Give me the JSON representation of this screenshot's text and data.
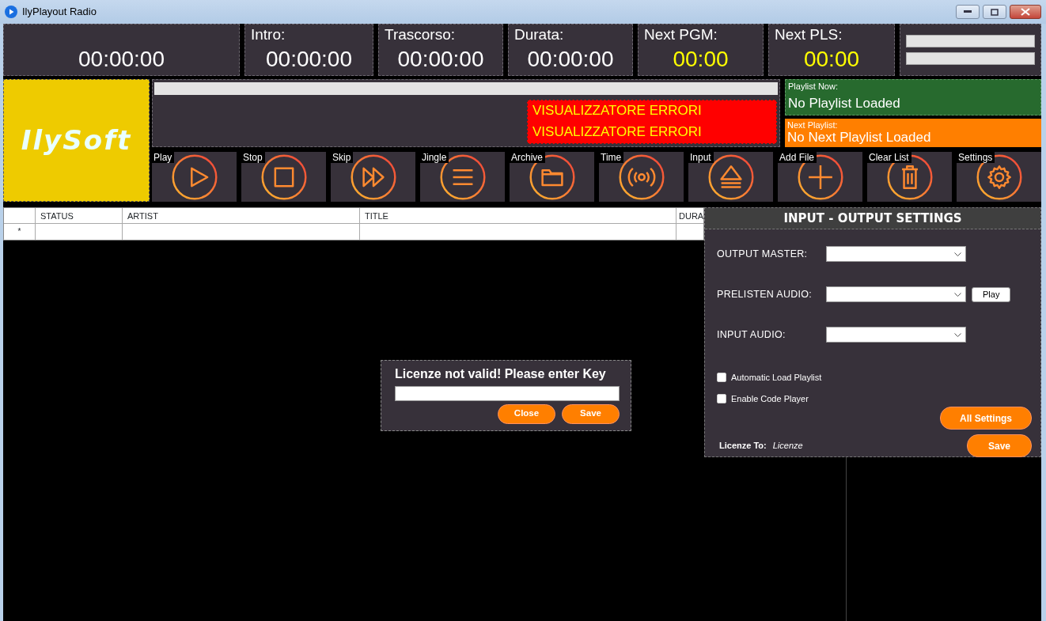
{
  "window": {
    "title": "IlyPlayout Radio"
  },
  "timers": [
    {
      "value": "00:00:00",
      "kind": "time"
    },
    {
      "label": "Intro:",
      "value": "00:00:00",
      "kind": "time"
    },
    {
      "label": "Trascorso:",
      "value": "00:00:00",
      "kind": "time"
    },
    {
      "label": "Durata:",
      "value": "00:00:00",
      "kind": "time"
    },
    {
      "label": "Next PGM:",
      "value": "00:00",
      "kind": "next"
    },
    {
      "label": "Next PLS:",
      "value": "00:00",
      "kind": "next"
    }
  ],
  "meters": [
    {
      "level": 0
    },
    {
      "level": 0
    }
  ],
  "logo": {
    "text": "IlySoft"
  },
  "progress": {
    "level": 0
  },
  "errors": [
    "VISUALIZZATORE ERRORI",
    "VISUALIZZATORE ERRORI"
  ],
  "playlist_now": {
    "label": "Playlist Now:",
    "value": "No Playlist Loaded"
  },
  "next_playlist": {
    "label": "Next Playlist:",
    "value": "No Next Playlist Loaded"
  },
  "controls": [
    {
      "label": "Play",
      "kind": "play"
    },
    {
      "label": "Stop",
      "kind": "stop"
    },
    {
      "label": "Skip",
      "kind": "skip"
    },
    {
      "label": "Jingle",
      "kind": "list"
    },
    {
      "label": "Archive",
      "kind": "folder"
    },
    {
      "label": "Time",
      "kind": "broadcast"
    },
    {
      "label": "Input",
      "kind": "eject"
    },
    {
      "label": "Add File",
      "kind": "add"
    },
    {
      "label": "Clear List",
      "kind": "trash"
    },
    {
      "label": "Settings",
      "kind": "gear"
    }
  ],
  "table": {
    "columns": [
      "STATUS",
      "ARTIST",
      "TITLE",
      "DURA"
    ],
    "rows": [
      {
        "marker": "*"
      }
    ]
  },
  "settings_panel": {
    "title": "INPUT - OUTPUT SETTINGS",
    "fields": [
      {
        "label": "OUTPUT MASTER:"
      },
      {
        "label": "PRELISTEN AUDIO:",
        "button": "Play"
      },
      {
        "label": "INPUT AUDIO:"
      }
    ],
    "options": [
      {
        "label": "Automatic Load Playlist",
        "checked": false
      },
      {
        "label": "Enable Code Player",
        "checked": false
      }
    ],
    "all_settings_button": "All Settings",
    "license_label": "Licenze To:",
    "license_value": "Licenze",
    "save_button": "Save"
  },
  "license_dialog": {
    "title": "Licenze not valid! Please enter Key",
    "buttons": [
      "Close",
      "Save"
    ]
  }
}
